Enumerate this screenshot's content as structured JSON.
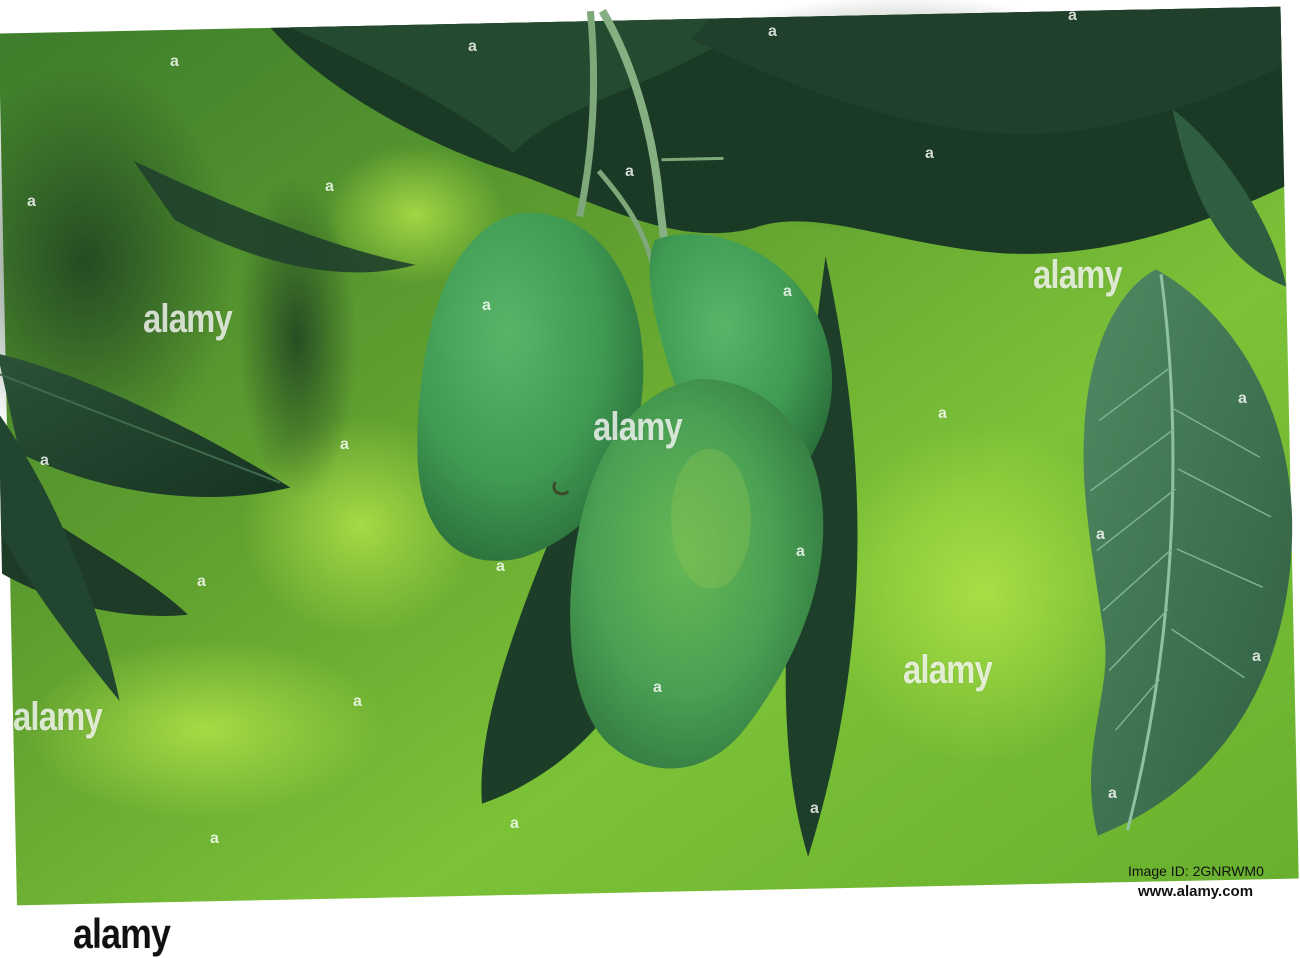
{
  "watermark": {
    "text": "alamy",
    "mark": "a"
  },
  "footer": {
    "image_id": "Image ID: 2GNRWM0",
    "url": "www.alamy.com",
    "logo": "alamy"
  },
  "colors": {
    "background_green": "#7fc636",
    "leaf_dark": "#1f3f2a",
    "mango_green": "#3f9a52"
  }
}
